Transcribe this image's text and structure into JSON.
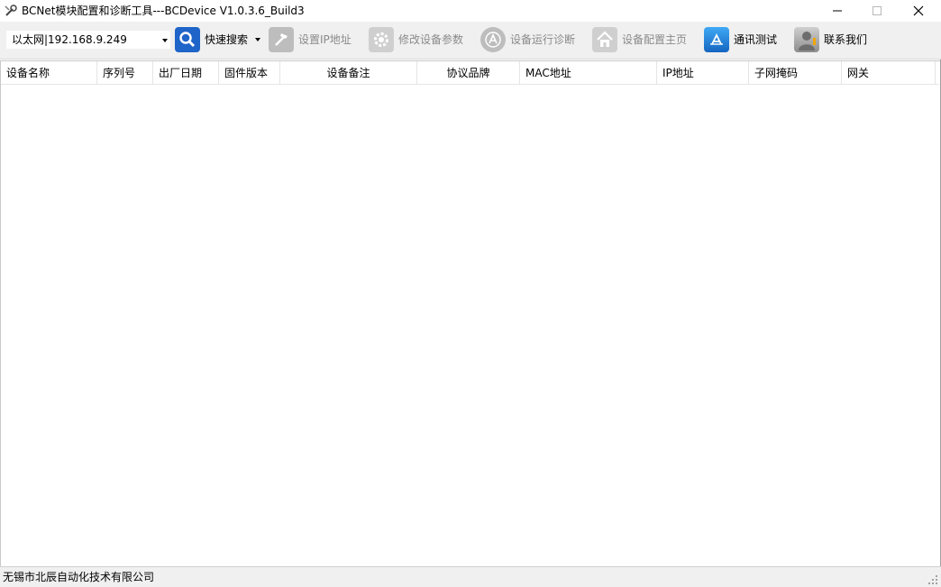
{
  "window": {
    "title": "BCNet模块配置和诊断工具---BCDevice V1.0.3.6_Build3"
  },
  "toolbar": {
    "interface_combo_value": "以太网|192.168.9.249",
    "quick_search_label": "快速搜索",
    "set_ip_label": "设置IP地址",
    "modify_params_label": "修改设备参数",
    "diagnostics_label": "设备运行诊断",
    "config_home_label": "设备配置主页",
    "comm_test_label": "通讯测试",
    "contact_label": "联系我们"
  },
  "grid": {
    "columns": [
      "设备名称",
      "序列号",
      "出厂日期",
      "固件版本",
      "设备备注",
      "协议品牌",
      "MAC地址",
      "IP地址",
      "子网掩码",
      "网关"
    ],
    "rows": []
  },
  "statusbar": {
    "company": "无锡市北辰自动化技术有限公司"
  },
  "colors": {
    "toolbar_bg": "#f0f0f0",
    "search_icon_bg": "#1f64c8",
    "disabled_text": "#8a8a8a"
  },
  "icons": [
    "app-icon",
    "search-icon",
    "hammer-icon",
    "gear-icon",
    "appstore-icon",
    "home-icon",
    "comm-test-icon",
    "person-icon"
  ]
}
